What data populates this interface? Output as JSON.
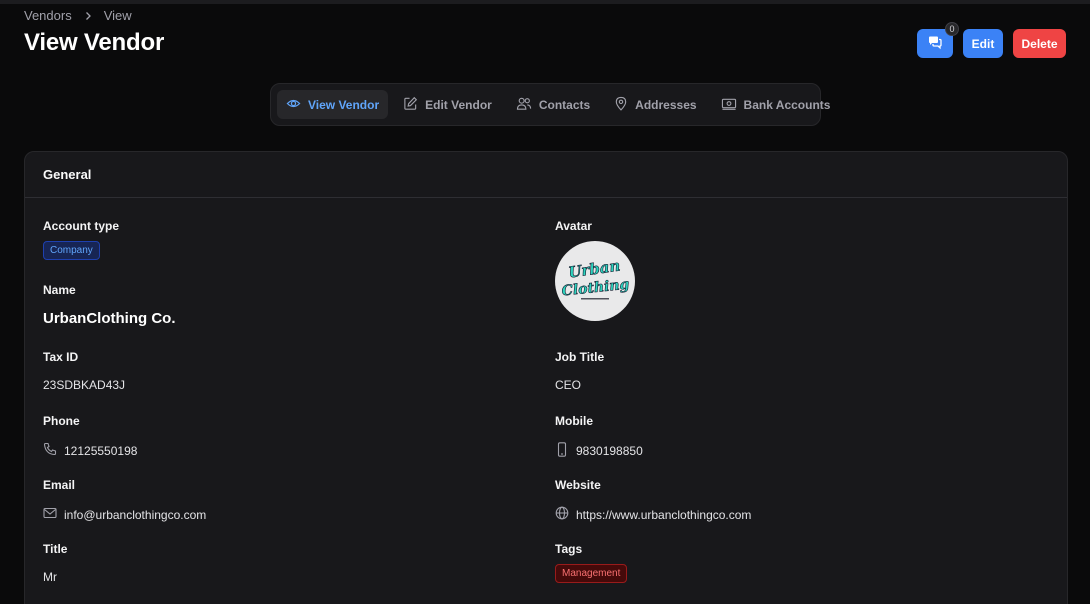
{
  "breadcrumb": {
    "items": [
      "Vendors",
      "View"
    ]
  },
  "page": {
    "title": "View Vendor"
  },
  "actions": {
    "chat_count": "0",
    "edit_label": "Edit",
    "delete_label": "Delete"
  },
  "tabs": [
    {
      "label": "View Vendor",
      "icon": "eye-icon",
      "active": true
    },
    {
      "label": "Edit Vendor",
      "icon": "pencil-square-icon",
      "active": false
    },
    {
      "label": "Contacts",
      "icon": "users-icon",
      "active": false
    },
    {
      "label": "Addresses",
      "icon": "map-pin-icon",
      "active": false
    },
    {
      "label": "Bank Accounts",
      "icon": "banknote-icon",
      "active": false
    }
  ],
  "section": {
    "title": "General"
  },
  "fields": {
    "account_type": {
      "label": "Account type",
      "value": "Company"
    },
    "name": {
      "label": "Name",
      "value": "UrbanClothing Co."
    },
    "tax_id": {
      "label": "Tax ID",
      "value": "23SDBKAD43J"
    },
    "phone": {
      "label": "Phone",
      "value": "12125550198",
      "icon": "phone-icon"
    },
    "email": {
      "label": "Email",
      "value": "info@urbanclothingco.com",
      "icon": "envelope-icon"
    },
    "title": {
      "label": "Title",
      "value": "Mr"
    },
    "avatar": {
      "label": "Avatar",
      "logo_text_1": "Urban",
      "logo_text_2": "Clothing"
    },
    "job_title": {
      "label": "Job Title",
      "value": "CEO"
    },
    "mobile": {
      "label": "Mobile",
      "value": "9830198850",
      "icon": "mobile-phone-icon"
    },
    "website": {
      "label": "Website",
      "value": "https://www.urbanclothingco.com",
      "icon": "globe-icon"
    },
    "tags": {
      "label": "Tags",
      "value": "Management"
    }
  },
  "colors": {
    "accent": "#3b82f6",
    "danger": "#ef4444",
    "background": "#0a0a0b",
    "card": "#18181b"
  }
}
